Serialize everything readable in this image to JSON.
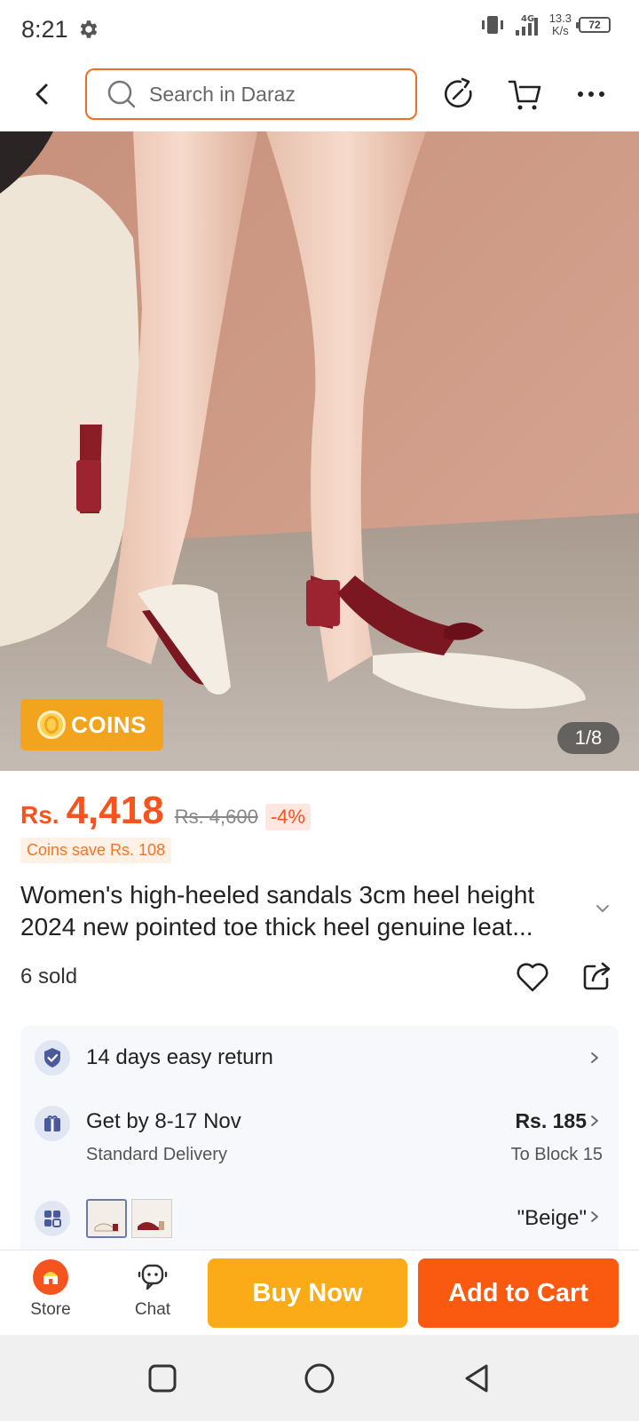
{
  "status": {
    "time": "8:21",
    "network": "4G",
    "speed_value": "13.3",
    "speed_unit": "K/s",
    "battery": "72"
  },
  "top_bar": {
    "search_placeholder": "Search in Daraz",
    "icons": [
      "back-arrow-icon",
      "search-icon",
      "refresh-share-icon",
      "cart-icon",
      "more-icon"
    ]
  },
  "gallery": {
    "badge_label": "COINS",
    "counter": "1/8"
  },
  "price": {
    "currency": "Rs.",
    "current": "4,418",
    "original": "Rs. 4,600",
    "discount": "-4%",
    "coins_save": "Coins save Rs. 108"
  },
  "product": {
    "title_line1": "Women's high-heeled sandals 3cm heel height",
    "title_line2": "2024 new pointed toe thick heel genuine leat...",
    "sold": "6 sold"
  },
  "info": {
    "return_text": "14 days easy return",
    "delivery_text": "Get by 8-17 Nov",
    "delivery_sub": "Standard Delivery",
    "delivery_price": "Rs. 185",
    "delivery_location": "To Block 15",
    "variant_selected": "\"Beige\""
  },
  "bottom": {
    "store_label": "Store",
    "chat_label": "Chat",
    "buy_now_label": "Buy Now",
    "add_to_cart_label": "Add to Cart"
  },
  "colors": {
    "accent": "#f5541e",
    "buy_now": "#fbab18",
    "add_to_cart": "#fa5a0f",
    "coins_badge": "#f2a41e"
  }
}
